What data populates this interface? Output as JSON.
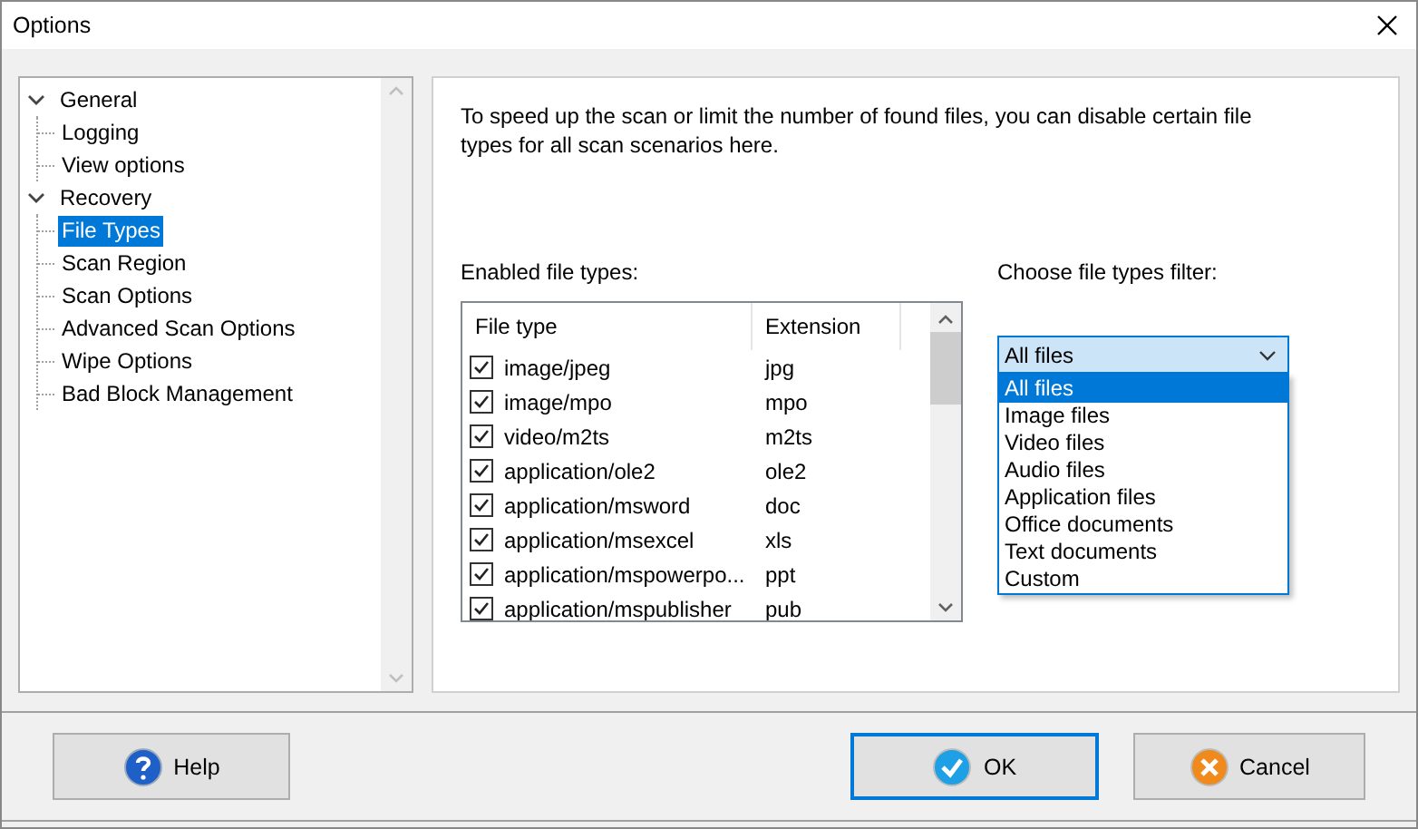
{
  "window": {
    "title": "Options"
  },
  "tree": [
    {
      "label": "General",
      "expanded": true,
      "selected": false,
      "children": [
        {
          "label": "Logging",
          "selected": false
        },
        {
          "label": "View options",
          "selected": false
        }
      ]
    },
    {
      "label": "Recovery",
      "expanded": true,
      "selected": false,
      "children": [
        {
          "label": "File Types",
          "selected": true
        },
        {
          "label": "Scan Region",
          "selected": false
        },
        {
          "label": "Scan Options",
          "selected": false
        },
        {
          "label": "Advanced Scan Options",
          "selected": false
        },
        {
          "label": "Wipe Options",
          "selected": false
        },
        {
          "label": "Bad Block Management",
          "selected": false
        }
      ]
    }
  ],
  "description": "To speed up the scan or limit the number of found files, you can disable certain file types for all scan scenarios here.",
  "file_types": {
    "label": "Enabled file types:",
    "columns": [
      "File type",
      "Extension"
    ],
    "rows": [
      {
        "type": "image/jpeg",
        "extension": "jpg",
        "checked": true
      },
      {
        "type": "image/mpo",
        "extension": "mpo",
        "checked": true
      },
      {
        "type": "video/m2ts",
        "extension": "m2ts",
        "checked": true
      },
      {
        "type": "application/ole2",
        "extension": "ole2",
        "checked": true
      },
      {
        "type": "application/msword",
        "extension": "doc",
        "checked": true
      },
      {
        "type": "application/msexcel",
        "extension": "xls",
        "checked": true
      },
      {
        "type": "application/mspowerpo...",
        "extension": "ppt",
        "checked": true
      },
      {
        "type": "application/mspublisher",
        "extension": "pub",
        "checked": true
      }
    ]
  },
  "filter": {
    "label": "Choose file types filter:",
    "value": "All files",
    "expanded": true,
    "options": [
      {
        "label": "All files",
        "selected": true
      },
      {
        "label": "Image files",
        "selected": false
      },
      {
        "label": "Video files",
        "selected": false
      },
      {
        "label": "Audio files",
        "selected": false
      },
      {
        "label": "Application files",
        "selected": false
      },
      {
        "label": "Office documents",
        "selected": false
      },
      {
        "label": "Text documents",
        "selected": false
      },
      {
        "label": "Custom",
        "selected": false
      }
    ]
  },
  "buttons": [
    {
      "label": "Help",
      "kind": "help"
    },
    {
      "label": "OK",
      "kind": "ok"
    },
    {
      "label": "Cancel",
      "kind": "cancel"
    }
  ]
}
